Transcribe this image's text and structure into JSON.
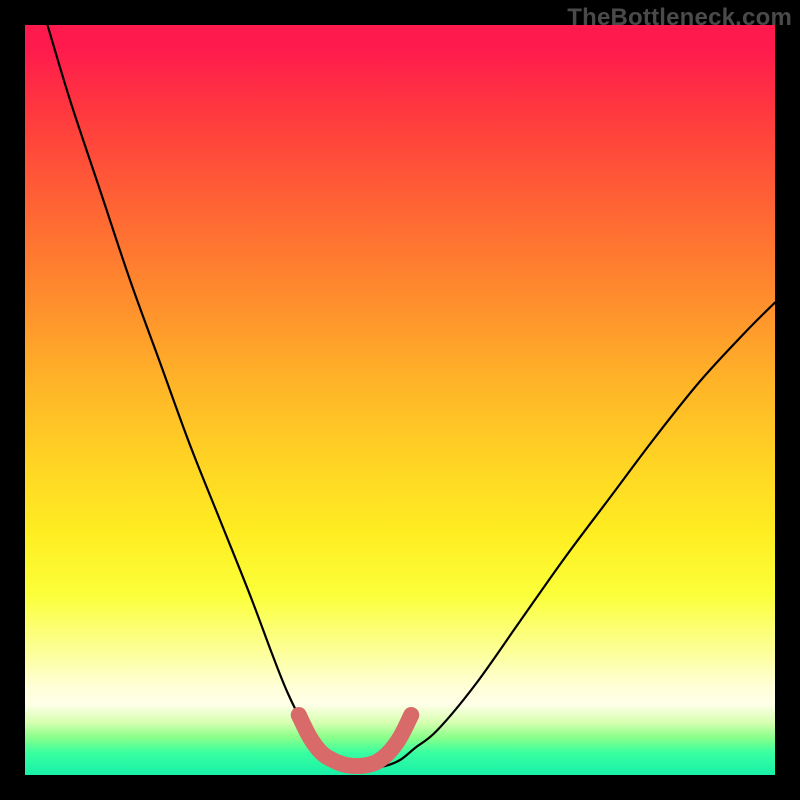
{
  "watermark": "TheBottleneck.com",
  "chart_data": {
    "type": "line",
    "title": "",
    "xlabel": "",
    "ylabel": "",
    "xlim": [
      0,
      100
    ],
    "ylim": [
      0,
      100
    ],
    "grid": false,
    "legend": false,
    "series": [
      {
        "name": "bottleneck-curve",
        "color": "#000000",
        "x": [
          3,
          6,
          10,
          14,
          18,
          22,
          26,
          30,
          33,
          35,
          37,
          39,
          40.5,
          42,
          44,
          46,
          48,
          50,
          52,
          55,
          60,
          66,
          72,
          78,
          84,
          90,
          96,
          100
        ],
        "y": [
          100,
          90,
          78,
          66,
          55,
          44,
          34,
          24,
          16,
          11,
          7,
          4,
          2.2,
          1.3,
          1,
          1,
          1.2,
          2,
          3.6,
          6,
          12,
          20.5,
          29,
          37,
          45,
          52.5,
          59,
          63
        ]
      },
      {
        "name": "bottleneck-highlight",
        "color": "#d86a6a",
        "x": [
          36.5,
          38,
          39.5,
          41,
          42.5,
          44,
          45.5,
          47,
          48.5,
          50,
          51.5
        ],
        "y": [
          8,
          5,
          3,
          2,
          1.4,
          1.2,
          1.3,
          1.8,
          3,
          5,
          8
        ]
      }
    ],
    "gradient_stops": [
      {
        "pos": 0.0,
        "color": "#ff1a4d"
      },
      {
        "pos": 0.12,
        "color": "#ff3a3e"
      },
      {
        "pos": 0.26,
        "color": "#ff6a33"
      },
      {
        "pos": 0.48,
        "color": "#ffb528"
      },
      {
        "pos": 0.68,
        "color": "#ffee22"
      },
      {
        "pos": 0.84,
        "color": "#fdff9e"
      },
      {
        "pos": 0.9,
        "color": "#ffffe8"
      },
      {
        "pos": 0.95,
        "color": "#8aff8a"
      },
      {
        "pos": 1.0,
        "color": "#18f0a8"
      }
    ]
  }
}
